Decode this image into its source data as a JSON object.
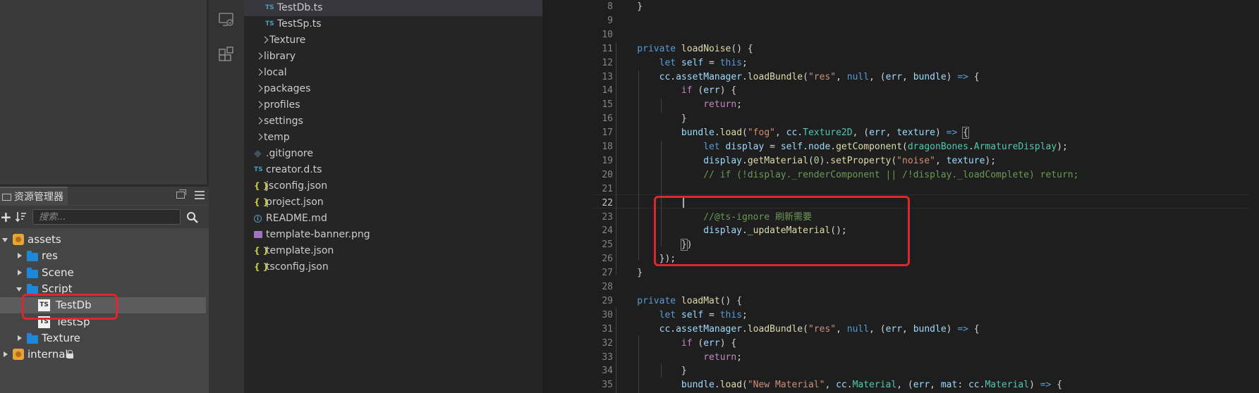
{
  "cocos": {
    "panel_title": "资源管理器",
    "search_placeholder": "搜索...",
    "tree": [
      {
        "label": "assets",
        "kind": "package",
        "depth": 0,
        "expanded": true
      },
      {
        "label": "res",
        "kind": "folder",
        "depth": 1,
        "expanded": false
      },
      {
        "label": "Scene",
        "kind": "folder",
        "depth": 1,
        "expanded": false
      },
      {
        "label": "Script",
        "kind": "folder",
        "depth": 1,
        "expanded": true
      },
      {
        "label": "TestDb",
        "kind": "ts",
        "depth": 2,
        "selected": true
      },
      {
        "label": "TestSp",
        "kind": "ts",
        "depth": 2
      },
      {
        "label": "Texture",
        "kind": "folder",
        "depth": 1,
        "expanded": false
      },
      {
        "label": "internal",
        "kind": "package",
        "depth": 0,
        "expanded": false,
        "locked": true
      }
    ]
  },
  "explorer": {
    "items": [
      {
        "label": "TestDb.ts",
        "kind": "ts",
        "depth": 2,
        "active": true
      },
      {
        "label": "TestSp.ts",
        "kind": "ts",
        "depth": 2
      },
      {
        "label": "Texture",
        "kind": "folder",
        "depth": 1
      },
      {
        "label": "library",
        "kind": "folder",
        "depth": 0
      },
      {
        "label": "local",
        "kind": "folder",
        "depth": 0
      },
      {
        "label": "packages",
        "kind": "folder",
        "depth": 0
      },
      {
        "label": "profiles",
        "kind": "folder",
        "depth": 0
      },
      {
        "label": "settings",
        "kind": "folder",
        "depth": 0
      },
      {
        "label": "temp",
        "kind": "folder",
        "depth": 0
      },
      {
        "label": ".gitignore",
        "kind": "git",
        "depth": 0
      },
      {
        "label": "creator.d.ts",
        "kind": "ts",
        "depth": 0
      },
      {
        "label": "jsconfig.json",
        "kind": "json",
        "depth": 0
      },
      {
        "label": "project.json",
        "kind": "json",
        "depth": 0
      },
      {
        "label": "README.md",
        "kind": "info",
        "depth": 0
      },
      {
        "label": "template-banner.png",
        "kind": "png",
        "depth": 0
      },
      {
        "label": "template.json",
        "kind": "json",
        "depth": 0
      },
      {
        "label": "tsconfig.json",
        "kind": "json",
        "depth": 0
      }
    ]
  },
  "editor": {
    "current_line": 22,
    "lines": [
      {
        "n": 8,
        "t": [
          [
            "pun",
            "    }"
          ]
        ]
      },
      {
        "n": 9,
        "t": []
      },
      {
        "n": 10,
        "t": []
      },
      {
        "n": 11,
        "t": [
          [
            "kw",
            "    private "
          ],
          [
            "fn",
            "loadNoise"
          ],
          [
            "pun",
            "() {"
          ]
        ]
      },
      {
        "n": 12,
        "t": [
          [
            "kw",
            "        let "
          ],
          [
            "var",
            "self"
          ],
          [
            "pun",
            " = "
          ],
          [
            "kw",
            "this"
          ],
          [
            "pun",
            ";"
          ]
        ]
      },
      {
        "n": 13,
        "t": [
          [
            "var",
            "        cc"
          ],
          [
            "pun",
            "."
          ],
          [
            "var",
            "assetManager"
          ],
          [
            "pun",
            "."
          ],
          [
            "fn",
            "loadBundle"
          ],
          [
            "pun",
            "("
          ],
          [
            "str",
            "\"res\""
          ],
          [
            "pun",
            ", "
          ],
          [
            "kw",
            "null"
          ],
          [
            "pun",
            ", ("
          ],
          [
            "var",
            "err"
          ],
          [
            "pun",
            ", "
          ],
          [
            "var",
            "bundle"
          ],
          [
            "pun",
            ") "
          ],
          [
            "kw",
            "=>"
          ],
          [
            "pun",
            " {"
          ]
        ]
      },
      {
        "n": 14,
        "t": [
          [
            "ctl",
            "            if "
          ],
          [
            "pun",
            "("
          ],
          [
            "var",
            "err"
          ],
          [
            "pun",
            ") {"
          ]
        ]
      },
      {
        "n": 15,
        "t": [
          [
            "ctl",
            "                return"
          ],
          [
            "pun",
            ";"
          ]
        ]
      },
      {
        "n": 16,
        "t": [
          [
            "pun",
            "            }"
          ]
        ]
      },
      {
        "n": 17,
        "t": [
          [
            "var",
            "            bundle"
          ],
          [
            "pun",
            "."
          ],
          [
            "fn",
            "load"
          ],
          [
            "pun",
            "("
          ],
          [
            "str",
            "\"fog\""
          ],
          [
            "pun",
            ", "
          ],
          [
            "var",
            "cc"
          ],
          [
            "pun",
            "."
          ],
          [
            "typ",
            "Texture2D"
          ],
          [
            "pun",
            ", ("
          ],
          [
            "var",
            "err"
          ],
          [
            "pun",
            ", "
          ],
          [
            "var",
            "texture"
          ],
          [
            "pun",
            ") "
          ],
          [
            "kw",
            "=>"
          ],
          [
            "pun",
            " "
          ],
          [
            "box",
            "{"
          ]
        ]
      },
      {
        "n": 18,
        "t": [
          [
            "kw",
            "                let "
          ],
          [
            "var",
            "display"
          ],
          [
            "pun",
            " = "
          ],
          [
            "var",
            "self"
          ],
          [
            "pun",
            "."
          ],
          [
            "var",
            "node"
          ],
          [
            "pun",
            "."
          ],
          [
            "fn",
            "getComponent"
          ],
          [
            "pun",
            "("
          ],
          [
            "typ",
            "dragonBones"
          ],
          [
            "pun",
            "."
          ],
          [
            "typ",
            "ArmatureDisplay"
          ],
          [
            "pun",
            ");"
          ]
        ]
      },
      {
        "n": 19,
        "t": [
          [
            "var",
            "                display"
          ],
          [
            "pun",
            "."
          ],
          [
            "fn",
            "getMaterial"
          ],
          [
            "pun",
            "("
          ],
          [
            "num",
            "0"
          ],
          [
            "pun",
            ")."
          ],
          [
            "fn",
            "setProperty"
          ],
          [
            "pun",
            "("
          ],
          [
            "str",
            "\"noise\""
          ],
          [
            "pun",
            ", "
          ],
          [
            "var",
            "texture"
          ],
          [
            "pun",
            ");"
          ]
        ]
      },
      {
        "n": 20,
        "t": [
          [
            "cmt",
            "                // if (!display._renderComponent || /!display._loadComplete) return;"
          ]
        ]
      },
      {
        "n": 21,
        "t": []
      },
      {
        "n": 22,
        "t": []
      },
      {
        "n": 23,
        "t": [
          [
            "cmt",
            "                //@ts-ignore 刷新需要"
          ]
        ]
      },
      {
        "n": 24,
        "t": [
          [
            "var",
            "                display"
          ],
          [
            "pun",
            "."
          ],
          [
            "fn",
            "_updateMaterial"
          ],
          [
            "pun",
            "();"
          ]
        ]
      },
      {
        "n": 25,
        "t": [
          [
            "pun",
            "            "
          ],
          [
            "box",
            "}"
          ],
          [
            "pun",
            ")"
          ]
        ]
      },
      {
        "n": 26,
        "t": [
          [
            "pun",
            "        });"
          ]
        ]
      },
      {
        "n": 27,
        "t": [
          [
            "pun",
            "    }"
          ]
        ]
      },
      {
        "n": 28,
        "t": []
      },
      {
        "n": 29,
        "t": [
          [
            "kw",
            "    private "
          ],
          [
            "fn",
            "loadMat"
          ],
          [
            "pun",
            "() {"
          ]
        ]
      },
      {
        "n": 30,
        "t": [
          [
            "kw",
            "        let "
          ],
          [
            "var",
            "self"
          ],
          [
            "pun",
            " = "
          ],
          [
            "kw",
            "this"
          ],
          [
            "pun",
            ";"
          ]
        ]
      },
      {
        "n": 31,
        "t": [
          [
            "var",
            "        cc"
          ],
          [
            "pun",
            "."
          ],
          [
            "var",
            "assetManager"
          ],
          [
            "pun",
            "."
          ],
          [
            "fn",
            "loadBundle"
          ],
          [
            "pun",
            "("
          ],
          [
            "str",
            "\"res\""
          ],
          [
            "pun",
            ", "
          ],
          [
            "kw",
            "null"
          ],
          [
            "pun",
            ", ("
          ],
          [
            "var",
            "err"
          ],
          [
            "pun",
            ", "
          ],
          [
            "var",
            "bundle"
          ],
          [
            "pun",
            ") "
          ],
          [
            "kw",
            "=>"
          ],
          [
            "pun",
            " {"
          ]
        ]
      },
      {
        "n": 32,
        "t": [
          [
            "ctl",
            "            if "
          ],
          [
            "pun",
            "("
          ],
          [
            "var",
            "err"
          ],
          [
            "pun",
            ") {"
          ]
        ]
      },
      {
        "n": 33,
        "t": [
          [
            "ctl",
            "                return"
          ],
          [
            "pun",
            ";"
          ]
        ]
      },
      {
        "n": 34,
        "t": [
          [
            "pun",
            "            }"
          ]
        ]
      },
      {
        "n": 35,
        "t": [
          [
            "var",
            "            bundle"
          ],
          [
            "pun",
            "."
          ],
          [
            "fn",
            "load"
          ],
          [
            "pun",
            "("
          ],
          [
            "str",
            "\"New Material\""
          ],
          [
            "pun",
            ", "
          ],
          [
            "var",
            "cc"
          ],
          [
            "pun",
            "."
          ],
          [
            "typ",
            "Material"
          ],
          [
            "pun",
            ", ("
          ],
          [
            "var",
            "err"
          ],
          [
            "pun",
            ", "
          ],
          [
            "var",
            "mat"
          ],
          [
            "pun",
            ": "
          ],
          [
            "var",
            "cc"
          ],
          [
            "pun",
            "."
          ],
          [
            "typ",
            "Material"
          ],
          [
            "pun",
            ") "
          ],
          [
            "kw",
            "=>"
          ],
          [
            "pun",
            " {"
          ]
        ]
      }
    ]
  }
}
